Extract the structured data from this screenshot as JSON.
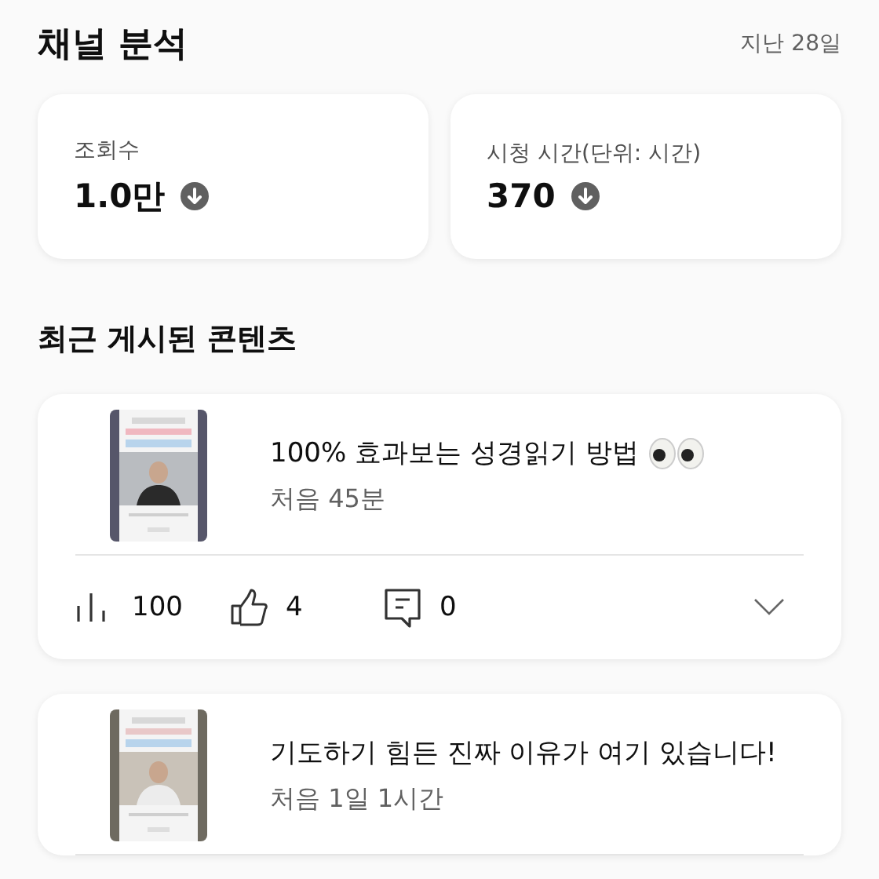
{
  "header": {
    "title": "채널 분석",
    "period": "지난 28일"
  },
  "metrics": [
    {
      "label": "조회수",
      "value": "1.0만",
      "falling": true
    },
    {
      "label": "시청 시간(단위: 시간)",
      "value": "370",
      "falling": true
    }
  ],
  "recent": {
    "title": "최근 게시된 콘텐츠",
    "videos": [
      {
        "title": "100% 효과보는 성경읽기 방법",
        "eyes_emoji": true,
        "age": "처음 45분",
        "stats": {
          "views": "100",
          "likes": "4",
          "comments": "0"
        }
      },
      {
        "title": "기도하기 힘든 진짜 이유가 여기 있습니다!",
        "age": "처음 1일 1시간"
      }
    ]
  }
}
